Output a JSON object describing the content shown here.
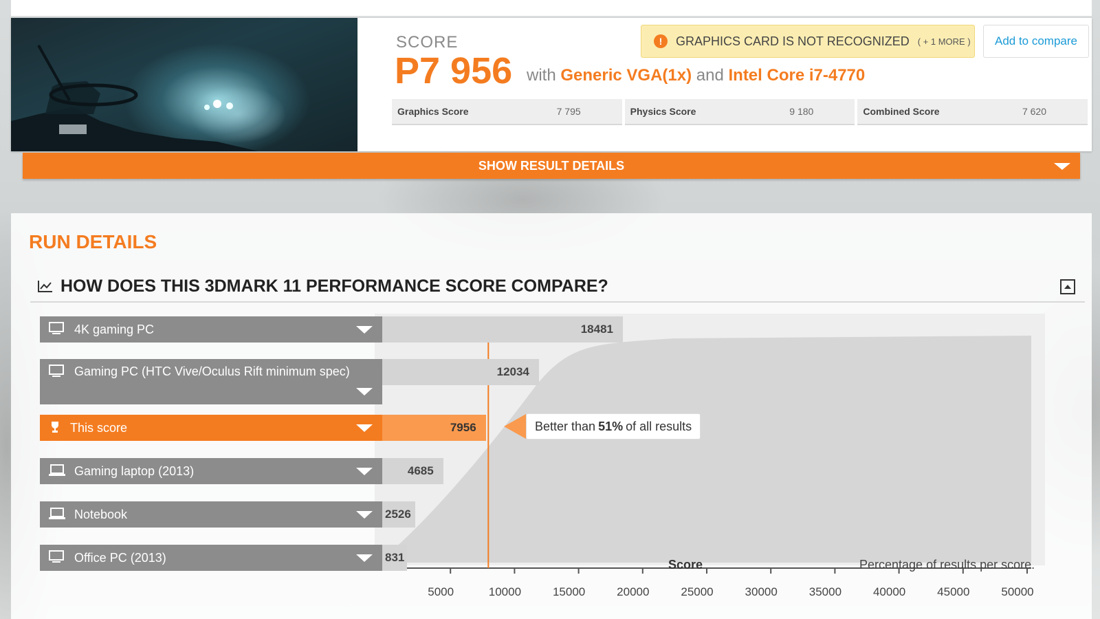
{
  "result": {
    "score_label": "SCORE",
    "score_value": "P7 956",
    "with_word": "with",
    "gpu": "Generic VGA(1x)",
    "and_word": "and",
    "cpu": "Intel Core i7-4770",
    "warning_text": "GRAPHICS CARD IS NOT RECOGNIZED",
    "warning_more": "( + 1 MORE )",
    "warning_icon": "exclamation-icon",
    "compare_label": "Add to compare",
    "subscores": [
      {
        "name": "Graphics Score",
        "value": "7 795"
      },
      {
        "name": "Physics Score",
        "value": "9 180"
      },
      {
        "name": "Combined Score",
        "value": "7 620"
      }
    ],
    "show_details_label": "SHOW RESULT DETAILS"
  },
  "run_details": {
    "title": "RUN DETAILS",
    "compare_heading": "HOW DOES THIS 3DMARK 11 PERFORMANCE SCORE COMPARE?"
  },
  "colors": {
    "accent": "#f47c20",
    "row_gray": "#8c8c8c",
    "link": "#1a9ad6"
  },
  "chart_data": {
    "type": "bar",
    "categories": [
      "4K gaming PC",
      "Gaming PC (HTC Vive/Oculus Rift minimum spec)",
      "This score",
      "Gaming laptop (2013)",
      "Notebook",
      "Office PC (2013)"
    ],
    "values": [
      18481,
      12034,
      7956,
      4685,
      2526,
      831
    ],
    "value_labels": [
      "18481",
      "12034",
      "7956",
      "4685",
      "2526",
      "831"
    ],
    "row_icons": [
      "monitor-icon",
      "monitor-icon",
      "trophy-icon",
      "laptop-icon",
      "laptop-icon",
      "monitor-icon"
    ],
    "highlight_index": 2,
    "callout": {
      "prefix": "Better than",
      "percent": "51%",
      "suffix": "of all results"
    },
    "xlabel": "Score",
    "note": "Percentage of results per score.",
    "xticks": [
      "5000",
      "10000",
      "15000",
      "20000",
      "25000",
      "30000",
      "35000",
      "40000",
      "45000",
      "50000"
    ],
    "xlim": [
      0,
      50000
    ]
  }
}
